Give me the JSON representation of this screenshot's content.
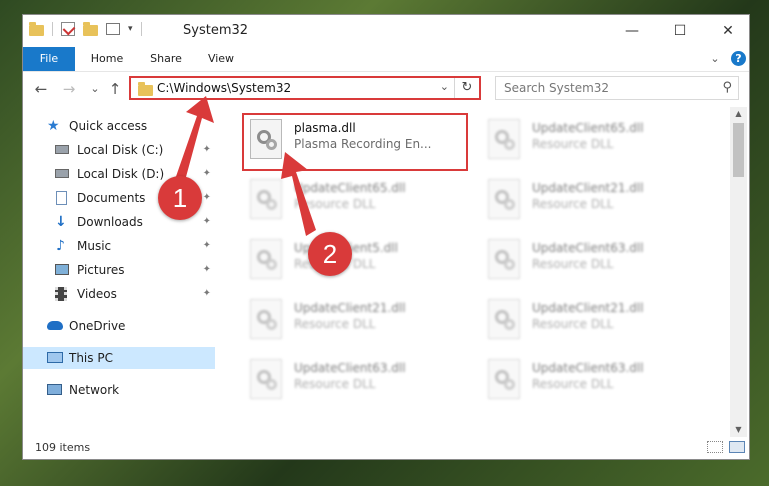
{
  "window": {
    "title": "System32",
    "controls": {
      "minimize": "—",
      "maximize": "☐",
      "close": "✕"
    }
  },
  "ribbon": {
    "tabs": [
      "File",
      "Home",
      "Share",
      "View"
    ],
    "expand_icon": "⌄",
    "help_icon": "?"
  },
  "nav": {
    "back_icon": "←",
    "forward_icon": "→",
    "recent_icon": "⌄",
    "up_icon": "↑",
    "address": "C:\\Windows\\System32",
    "refresh_icon": "↻",
    "search_placeholder": "Search System32",
    "search_icon": "⚲"
  },
  "sidebar": {
    "items": [
      {
        "label": "Quick access",
        "icon": "star-icon"
      },
      {
        "label": "Local Disk (C:)",
        "icon": "drive-icon",
        "pinned": true
      },
      {
        "label": "Local Disk (D:)",
        "icon": "drive-icon",
        "pinned": true
      },
      {
        "label": "Documents",
        "icon": "documents-icon",
        "pinned": true
      },
      {
        "label": "Downloads",
        "icon": "downloads-icon",
        "pinned": true
      },
      {
        "label": "Music",
        "icon": "music-icon",
        "pinned": true
      },
      {
        "label": "Pictures",
        "icon": "pictures-icon",
        "pinned": true
      },
      {
        "label": "Videos",
        "icon": "videos-icon",
        "pinned": true
      },
      {
        "label": "OneDrive",
        "icon": "cloud-icon"
      },
      {
        "label": "This PC",
        "icon": "computer-icon",
        "selected": true
      },
      {
        "label": "Network",
        "icon": "network-icon"
      }
    ],
    "pin_glyph": "📌"
  },
  "files": [
    {
      "name": "plasma.dll",
      "type": "Plasma Recording En...",
      "highlighted": true
    },
    {
      "name": "UpdateClient65.dll",
      "type": "Resource DLL"
    },
    {
      "name": "UpdateClient65.dll",
      "type": "Resource DLL"
    },
    {
      "name": "UpdateClient21.dll",
      "type": "Resource DLL"
    },
    {
      "name": "UpdateClient5.dll",
      "type": "Resource DLL"
    },
    {
      "name": "UpdateClient63.dll",
      "type": "Resource DLL"
    },
    {
      "name": "UpdateClient21.dll",
      "type": "Resource DLL"
    },
    {
      "name": "UpdateClient21.dll",
      "type": "Resource DLL"
    },
    {
      "name": "UpdateClient63.dll",
      "type": "Resource DLL"
    },
    {
      "name": "UpdateClient63.dll",
      "type": "Resource DLL"
    }
  ],
  "status": {
    "item_count": "109 items"
  },
  "callouts": [
    "1",
    "2"
  ],
  "colors": {
    "accent": "#1979ca",
    "highlight": "#d93a3a",
    "selection": "#cce8ff"
  }
}
